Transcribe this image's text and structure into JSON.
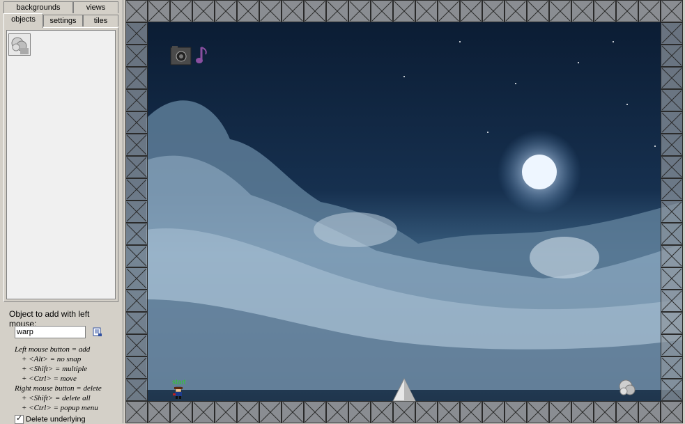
{
  "tabs": {
    "backgrounds": "backgrounds",
    "views": "views",
    "objects": "objects",
    "settings": "settings",
    "tiles": "tiles"
  },
  "object_panel": {
    "label": "Object to add with left mouse:",
    "selected_object": "warp",
    "help": [
      "Left mouse button = add",
      "+ <Alt> = no snap",
      "+ <Shift> = multiple",
      "+ <Ctrl> = move",
      "Right mouse button = delete",
      "+ <Shift> = delete all",
      "+ <Ctrl> = popup menu"
    ],
    "delete_underlying": "Delete underlying"
  },
  "room": {
    "start_label": "start",
    "colors": {
      "start_text": "#2ecc2e",
      "sky_top": "#0a1a30",
      "moon": "#eef6ff"
    },
    "icons": [
      "camera-icon",
      "music-note-icon",
      "warp-object-icon",
      "spike-icon",
      "player-sprite-icon"
    ]
  }
}
